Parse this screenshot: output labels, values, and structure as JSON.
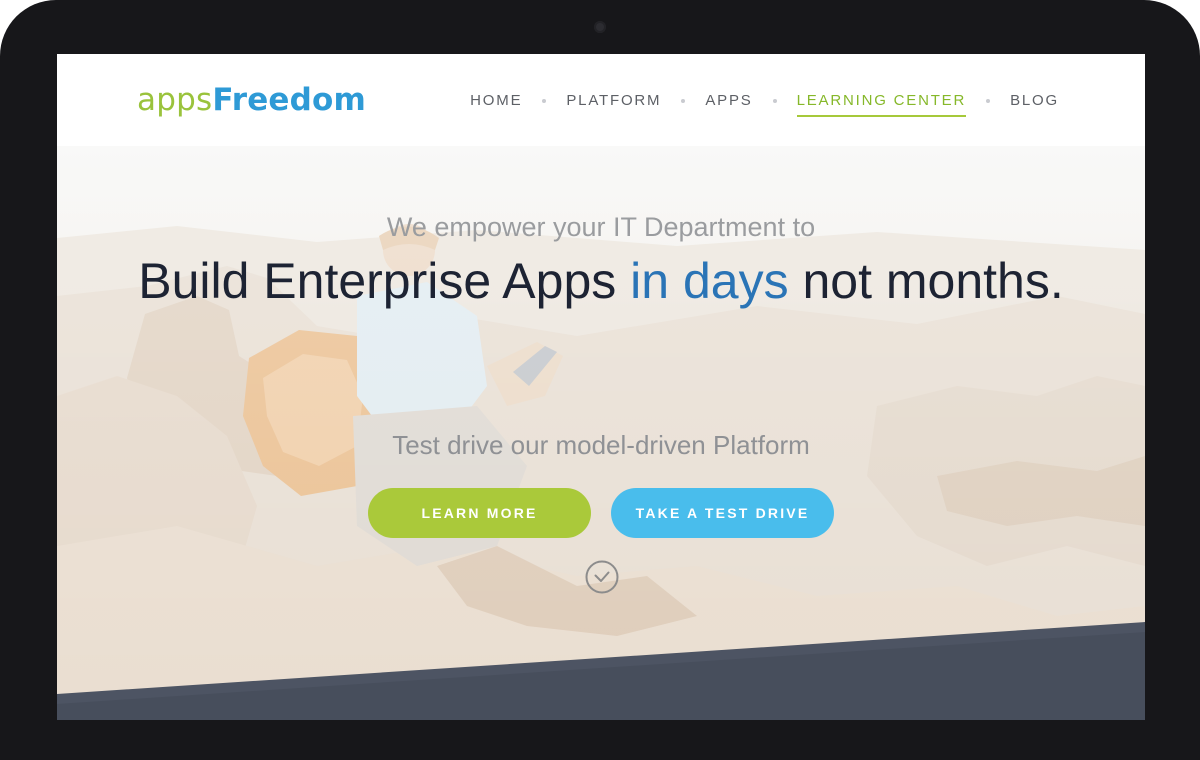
{
  "logo": {
    "light": "apps",
    "bold": "Freedom"
  },
  "nav": {
    "items": [
      {
        "label": "HOME",
        "active": false
      },
      {
        "label": "PLATFORM",
        "active": false
      },
      {
        "label": "APPS",
        "active": false
      },
      {
        "label": "LEARNING CENTER",
        "active": true
      },
      {
        "label": "BLOG",
        "active": false
      }
    ]
  },
  "hero": {
    "subtitle": "We empower your IT Department to",
    "title_part1": "Build Enterprise Apps ",
    "title_accent": "in days",
    "title_part2": " not months.",
    "test_drive_text": "Test drive our model-driven Platform",
    "learn_more_label": "LEARN MORE",
    "test_drive_label": "TAKE A TEST DRIVE"
  },
  "icons": {
    "scroll": "check-circle-icon",
    "camera": "camera-icon"
  },
  "colors": {
    "green": "#aac93a",
    "blue": "#49bdec",
    "logo_green": "#9ac33c",
    "logo_blue": "#2e9ad6",
    "title_accent": "#2a74b6",
    "frame": "#17171a"
  }
}
